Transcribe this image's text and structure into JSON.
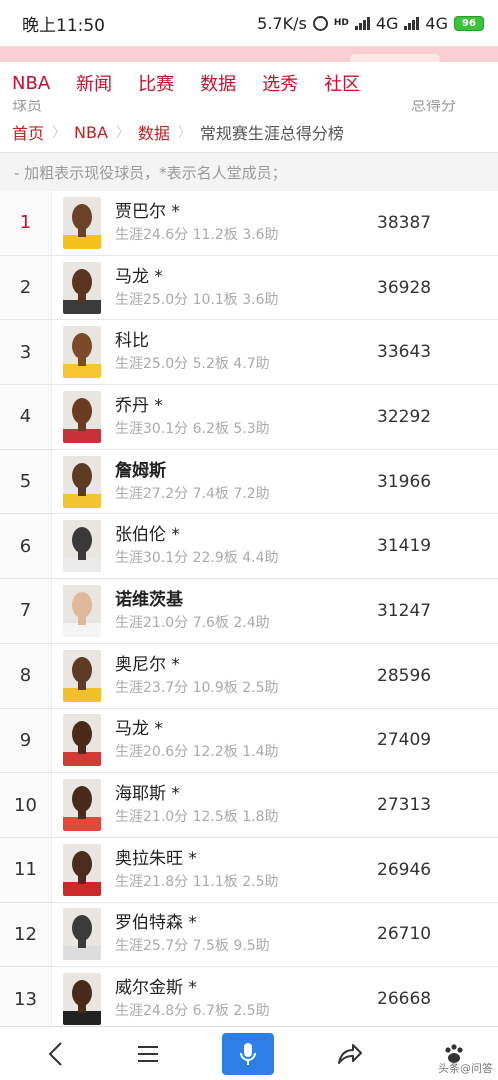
{
  "status_bar": {
    "time": "晚上11:50",
    "speed": "5.7K/s",
    "net1": "4G",
    "net2": "4G",
    "battery": "96"
  },
  "nav": {
    "items": [
      "NBA",
      "新闻",
      "比赛",
      "数据",
      "选秀",
      "社区"
    ]
  },
  "table_header": {
    "player_col": "球员",
    "points_col": "总得分"
  },
  "breadcrumb": {
    "home": "首页",
    "nba": "NBA",
    "data": "数据",
    "current": "常规赛生涯总得分榜"
  },
  "note": "- 加粗表示现役球员，*表示名人堂成员；",
  "players": [
    {
      "rank": "1",
      "name": "贾巴尔 *",
      "stats": "生涯24.6分 11.2板 3.6助",
      "points": "38387",
      "active": false,
      "jersey": "#f5c21b",
      "skin": "#6b4227"
    },
    {
      "rank": "2",
      "name": "马龙 *",
      "stats": "生涯25.0分 10.1板 3.6助",
      "points": "36928",
      "active": false,
      "jersey": "#3b3b3b",
      "skin": "#5a3420"
    },
    {
      "rank": "3",
      "name": "科比",
      "stats": "生涯25.0分 5.2板 4.7助",
      "points": "33643",
      "active": false,
      "jersey": "#f6c630",
      "skin": "#7a4a2a"
    },
    {
      "rank": "4",
      "name": "乔丹 *",
      "stats": "生涯30.1分 6.2板 5.3助",
      "points": "32292",
      "active": false,
      "jersey": "#c5323a",
      "skin": "#6a3d22"
    },
    {
      "rank": "5",
      "name": "詹姆斯",
      "stats": "生涯27.2分 7.4板 7.2助",
      "points": "31966",
      "active": true,
      "jersey": "#f3c431",
      "skin": "#5d3a22"
    },
    {
      "rank": "6",
      "name": "张伯伦 *",
      "stats": "生涯30.1分 22.9板 4.4助",
      "points": "31419",
      "active": false,
      "jersey": "#eaeaea",
      "skin": "#3a3a3a"
    },
    {
      "rank": "7",
      "name": "诺维茨基",
      "stats": "生涯21.0分 7.6板 2.4助",
      "points": "31247",
      "active": true,
      "jersey": "#f3f3f3",
      "skin": "#e0b89a"
    },
    {
      "rank": "8",
      "name": "奥尼尔 *",
      "stats": "生涯23.7分 10.9板 2.5助",
      "points": "28596",
      "active": false,
      "jersey": "#f1c12c",
      "skin": "#5c3a25"
    },
    {
      "rank": "9",
      "name": "马龙 *",
      "stats": "生涯20.6分 12.2板 1.4助",
      "points": "27409",
      "active": false,
      "jersey": "#d13b33",
      "skin": "#4b2a18"
    },
    {
      "rank": "10",
      "name": "海耶斯 *",
      "stats": "生涯21.0分 12.5板 1.8助",
      "points": "27313",
      "active": false,
      "jersey": "#e04a3a",
      "skin": "#4a2b1b"
    },
    {
      "rank": "11",
      "name": "奥拉朱旺 *",
      "stats": "生涯21.8分 11.1板 2.5助",
      "points": "26946",
      "active": false,
      "jersey": "#cc2a2a",
      "skin": "#4b2c1a"
    },
    {
      "rank": "12",
      "name": "罗伯特森 *",
      "stats": "生涯25.7分 7.5板 9.5助",
      "points": "26710",
      "active": false,
      "jersey": "#dddddd",
      "skin": "#3b3b3b"
    },
    {
      "rank": "13",
      "name": "威尔金斯 *",
      "stats": "生涯24.8分 6.7板 2.5助",
      "points": "26668",
      "active": false,
      "jersey": "#222222",
      "skin": "#4a2b1a"
    }
  ],
  "bottom_bar": {
    "watermark": "头条@问答"
  }
}
